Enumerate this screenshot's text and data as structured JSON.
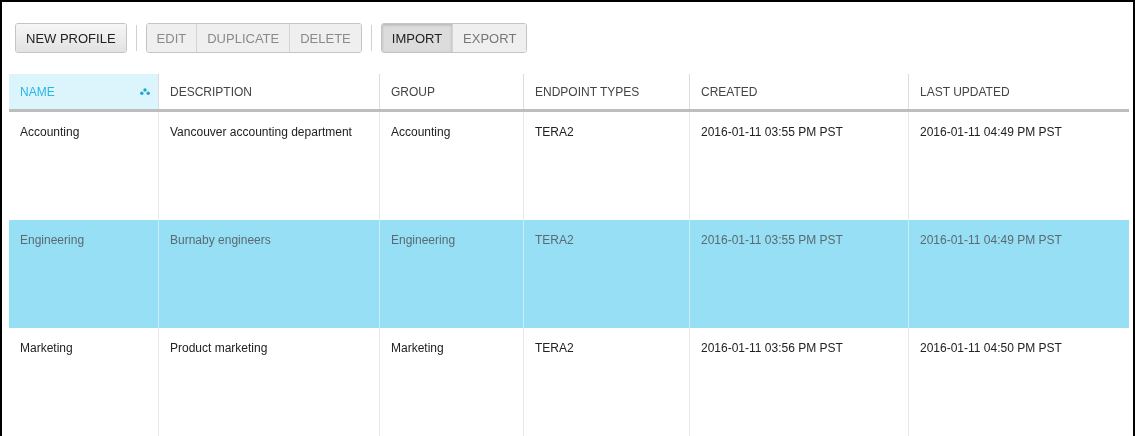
{
  "toolbar": {
    "groups": [
      {
        "kind": "single",
        "buttons": [
          {
            "label": "NEW PROFILE",
            "disabled": false
          }
        ]
      },
      {
        "kind": "actions",
        "buttons": [
          {
            "label": "EDIT",
            "disabled": true
          },
          {
            "label": "DUPLICATE",
            "disabled": true
          },
          {
            "label": "DELETE",
            "disabled": true
          }
        ]
      },
      {
        "kind": "toggle",
        "buttons": [
          {
            "label": "IMPORT",
            "selected": true
          },
          {
            "label": "EXPORT",
            "selected": false
          }
        ]
      }
    ]
  },
  "table": {
    "columns": [
      {
        "label": "NAME",
        "sorted": true
      },
      {
        "label": "DESCRIPTION",
        "sorted": false
      },
      {
        "label": "GROUP",
        "sorted": false
      },
      {
        "label": "ENDPOINT TYPES",
        "sorted": false
      },
      {
        "label": "CREATED",
        "sorted": false
      },
      {
        "label": "LAST UPDATED",
        "sorted": false
      }
    ],
    "rows": [
      {
        "selected": false,
        "cells": [
          "Accounting",
          "Vancouver accounting department",
          "Accounting",
          "TERA2",
          "2016-01-11 03:55 PM PST",
          "2016-01-11 04:49 PM PST"
        ]
      },
      {
        "selected": true,
        "cells": [
          "Engineering",
          "Burnaby engineers",
          "Engineering",
          "TERA2",
          "2016-01-11 03:55 PM PST",
          "2016-01-11 04:49 PM PST"
        ]
      },
      {
        "selected": false,
        "cells": [
          "Marketing",
          "Product marketing",
          "Marketing",
          "TERA2",
          "2016-01-11 03:56 PM PST",
          "2016-01-11 04:50 PM PST"
        ]
      }
    ]
  }
}
